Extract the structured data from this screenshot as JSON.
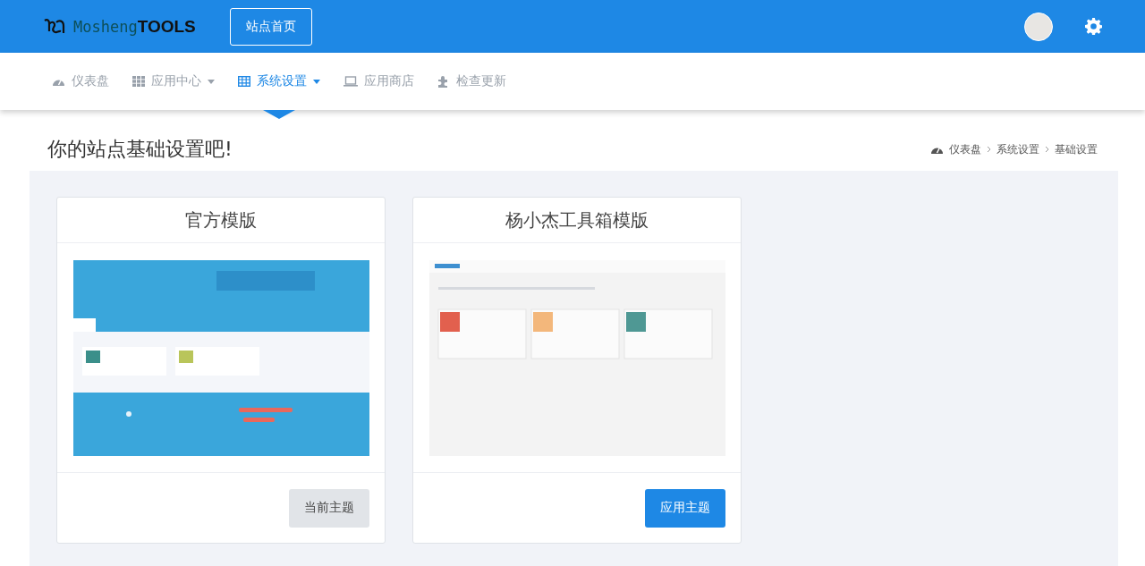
{
  "header": {
    "logo": {
      "script": "Mosheng",
      "tools": "TOOLS"
    },
    "home_button": "站点首页"
  },
  "nav": [
    {
      "label": "仪表盘",
      "dropdown": false,
      "selected": false
    },
    {
      "label": "应用中心",
      "dropdown": true,
      "selected": false
    },
    {
      "label": "系统设置",
      "dropdown": true,
      "selected": true
    },
    {
      "label": "应用商店",
      "dropdown": false,
      "selected": false
    },
    {
      "label": "检查更新",
      "dropdown": false,
      "selected": false
    }
  ],
  "page_title": "你的站点基础设置吧!",
  "breadcrumb": [
    "仪表盘",
    "系统设置",
    "基础设置"
  ],
  "themes": [
    {
      "title": "官方模版",
      "button": "当前主题",
      "current": true
    },
    {
      "title": "杨小杰工具箱模版",
      "button": "应用主题",
      "current": false
    }
  ]
}
